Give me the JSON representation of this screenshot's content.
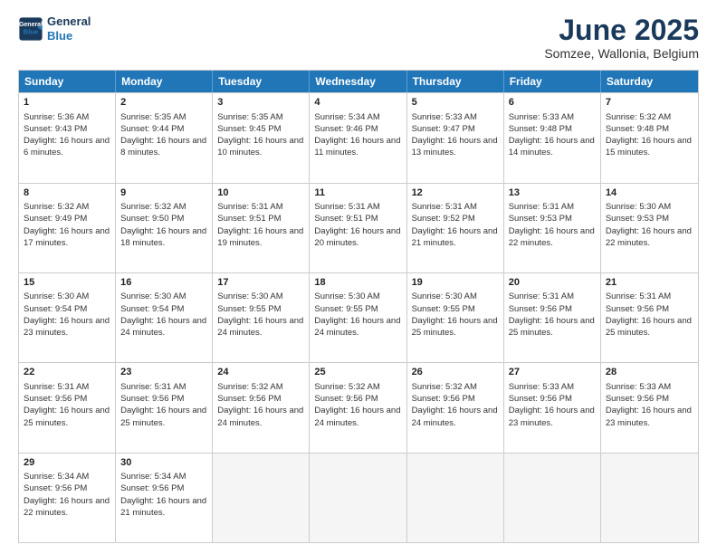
{
  "header": {
    "logo_line1": "General",
    "logo_line2": "Blue",
    "title": "June 2025",
    "subtitle": "Somzee, Wallonia, Belgium"
  },
  "days_of_week": [
    "Sunday",
    "Monday",
    "Tuesday",
    "Wednesday",
    "Thursday",
    "Friday",
    "Saturday"
  ],
  "weeks": [
    [
      {
        "num": "1",
        "sunrise": "Sunrise: 5:36 AM",
        "sunset": "Sunset: 9:43 PM",
        "daylight": "Daylight: 16 hours and 6 minutes."
      },
      {
        "num": "2",
        "sunrise": "Sunrise: 5:35 AM",
        "sunset": "Sunset: 9:44 PM",
        "daylight": "Daylight: 16 hours and 8 minutes."
      },
      {
        "num": "3",
        "sunrise": "Sunrise: 5:35 AM",
        "sunset": "Sunset: 9:45 PM",
        "daylight": "Daylight: 16 hours and 10 minutes."
      },
      {
        "num": "4",
        "sunrise": "Sunrise: 5:34 AM",
        "sunset": "Sunset: 9:46 PM",
        "daylight": "Daylight: 16 hours and 11 minutes."
      },
      {
        "num": "5",
        "sunrise": "Sunrise: 5:33 AM",
        "sunset": "Sunset: 9:47 PM",
        "daylight": "Daylight: 16 hours and 13 minutes."
      },
      {
        "num": "6",
        "sunrise": "Sunrise: 5:33 AM",
        "sunset": "Sunset: 9:48 PM",
        "daylight": "Daylight: 16 hours and 14 minutes."
      },
      {
        "num": "7",
        "sunrise": "Sunrise: 5:32 AM",
        "sunset": "Sunset: 9:48 PM",
        "daylight": "Daylight: 16 hours and 15 minutes."
      }
    ],
    [
      {
        "num": "8",
        "sunrise": "Sunrise: 5:32 AM",
        "sunset": "Sunset: 9:49 PM",
        "daylight": "Daylight: 16 hours and 17 minutes."
      },
      {
        "num": "9",
        "sunrise": "Sunrise: 5:32 AM",
        "sunset": "Sunset: 9:50 PM",
        "daylight": "Daylight: 16 hours and 18 minutes."
      },
      {
        "num": "10",
        "sunrise": "Sunrise: 5:31 AM",
        "sunset": "Sunset: 9:51 PM",
        "daylight": "Daylight: 16 hours and 19 minutes."
      },
      {
        "num": "11",
        "sunrise": "Sunrise: 5:31 AM",
        "sunset": "Sunset: 9:51 PM",
        "daylight": "Daylight: 16 hours and 20 minutes."
      },
      {
        "num": "12",
        "sunrise": "Sunrise: 5:31 AM",
        "sunset": "Sunset: 9:52 PM",
        "daylight": "Daylight: 16 hours and 21 minutes."
      },
      {
        "num": "13",
        "sunrise": "Sunrise: 5:31 AM",
        "sunset": "Sunset: 9:53 PM",
        "daylight": "Daylight: 16 hours and 22 minutes."
      },
      {
        "num": "14",
        "sunrise": "Sunrise: 5:30 AM",
        "sunset": "Sunset: 9:53 PM",
        "daylight": "Daylight: 16 hours and 22 minutes."
      }
    ],
    [
      {
        "num": "15",
        "sunrise": "Sunrise: 5:30 AM",
        "sunset": "Sunset: 9:54 PM",
        "daylight": "Daylight: 16 hours and 23 minutes."
      },
      {
        "num": "16",
        "sunrise": "Sunrise: 5:30 AM",
        "sunset": "Sunset: 9:54 PM",
        "daylight": "Daylight: 16 hours and 24 minutes."
      },
      {
        "num": "17",
        "sunrise": "Sunrise: 5:30 AM",
        "sunset": "Sunset: 9:55 PM",
        "daylight": "Daylight: 16 hours and 24 minutes."
      },
      {
        "num": "18",
        "sunrise": "Sunrise: 5:30 AM",
        "sunset": "Sunset: 9:55 PM",
        "daylight": "Daylight: 16 hours and 24 minutes."
      },
      {
        "num": "19",
        "sunrise": "Sunrise: 5:30 AM",
        "sunset": "Sunset: 9:55 PM",
        "daylight": "Daylight: 16 hours and 25 minutes."
      },
      {
        "num": "20",
        "sunrise": "Sunrise: 5:31 AM",
        "sunset": "Sunset: 9:56 PM",
        "daylight": "Daylight: 16 hours and 25 minutes."
      },
      {
        "num": "21",
        "sunrise": "Sunrise: 5:31 AM",
        "sunset": "Sunset: 9:56 PM",
        "daylight": "Daylight: 16 hours and 25 minutes."
      }
    ],
    [
      {
        "num": "22",
        "sunrise": "Sunrise: 5:31 AM",
        "sunset": "Sunset: 9:56 PM",
        "daylight": "Daylight: 16 hours and 25 minutes."
      },
      {
        "num": "23",
        "sunrise": "Sunrise: 5:31 AM",
        "sunset": "Sunset: 9:56 PM",
        "daylight": "Daylight: 16 hours and 25 minutes."
      },
      {
        "num": "24",
        "sunrise": "Sunrise: 5:32 AM",
        "sunset": "Sunset: 9:56 PM",
        "daylight": "Daylight: 16 hours and 24 minutes."
      },
      {
        "num": "25",
        "sunrise": "Sunrise: 5:32 AM",
        "sunset": "Sunset: 9:56 PM",
        "daylight": "Daylight: 16 hours and 24 minutes."
      },
      {
        "num": "26",
        "sunrise": "Sunrise: 5:32 AM",
        "sunset": "Sunset: 9:56 PM",
        "daylight": "Daylight: 16 hours and 24 minutes."
      },
      {
        "num": "27",
        "sunrise": "Sunrise: 5:33 AM",
        "sunset": "Sunset: 9:56 PM",
        "daylight": "Daylight: 16 hours and 23 minutes."
      },
      {
        "num": "28",
        "sunrise": "Sunrise: 5:33 AM",
        "sunset": "Sunset: 9:56 PM",
        "daylight": "Daylight: 16 hours and 23 minutes."
      }
    ],
    [
      {
        "num": "29",
        "sunrise": "Sunrise: 5:34 AM",
        "sunset": "Sunset: 9:56 PM",
        "daylight": "Daylight: 16 hours and 22 minutes."
      },
      {
        "num": "30",
        "sunrise": "Sunrise: 5:34 AM",
        "sunset": "Sunset: 9:56 PM",
        "daylight": "Daylight: 16 hours and 21 minutes."
      },
      {
        "num": "",
        "sunrise": "",
        "sunset": "",
        "daylight": ""
      },
      {
        "num": "",
        "sunrise": "",
        "sunset": "",
        "daylight": ""
      },
      {
        "num": "",
        "sunrise": "",
        "sunset": "",
        "daylight": ""
      },
      {
        "num": "",
        "sunrise": "",
        "sunset": "",
        "daylight": ""
      },
      {
        "num": "",
        "sunrise": "",
        "sunset": "",
        "daylight": ""
      }
    ]
  ]
}
